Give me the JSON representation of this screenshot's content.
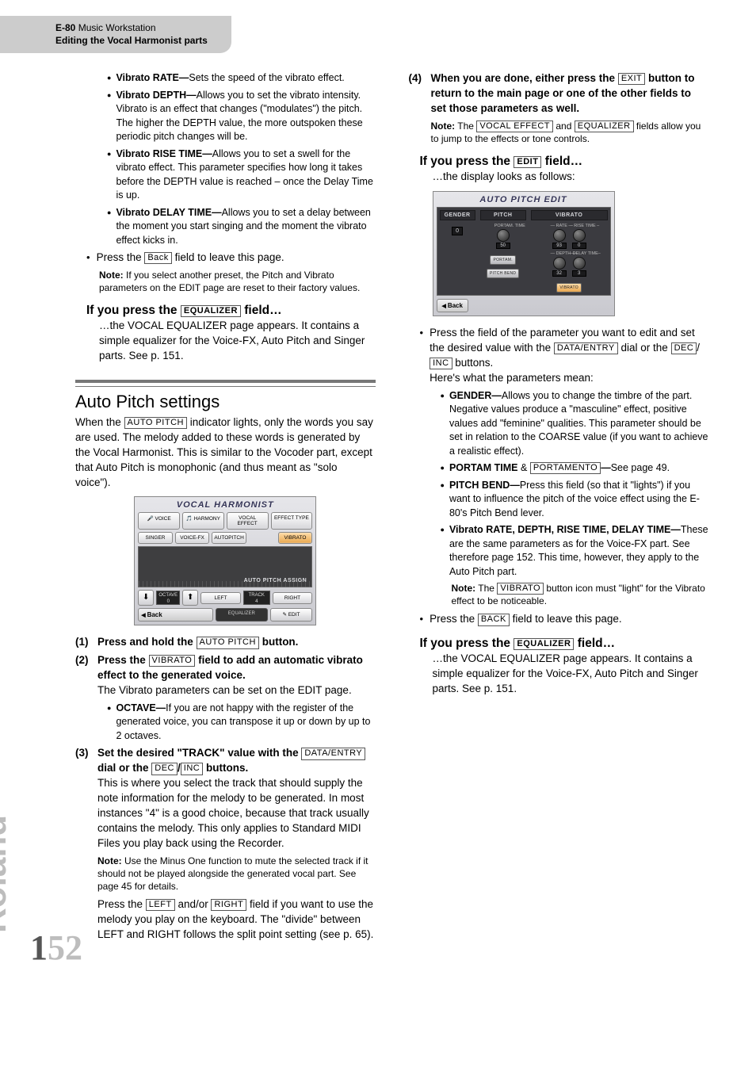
{
  "header": {
    "product": "E-80",
    "product_suffix": "Music Workstation",
    "subtitle": "Editing the Vocal Harmonist parts"
  },
  "col1": {
    "vib_rate": {
      "label": "Vibrato RATE—",
      "text": "Sets the speed of the vibrato effect."
    },
    "vib_depth": {
      "label": "Vibrato DEPTH—",
      "text": "Allows you to set the vibrato intensity. Vibrato is an effect that changes (\"modulates\") the pitch. The higher the DEPTH value, the more outspoken these periodic pitch changes will be."
    },
    "vib_rise": {
      "label": "Vibrato RISE TIME—",
      "text": "Allows you to set a swell for the vibrato effect. This parameter specifies how long it takes before the DEPTH value is reached – once the Delay Time is up."
    },
    "vib_delay": {
      "label": "Vibrato DELAY TIME—",
      "text": "Allows you to set a delay between the moment you start singing and the moment the vibrato effect kicks in."
    },
    "back_bullet": {
      "pre": "Press the ",
      "box": "Back",
      "post": " field to leave this page."
    },
    "back_note": {
      "prefix": "Note:",
      "text": " If you select another preset, the Pitch and Vibrato parameters on the EDIT page are reset to their factory values."
    },
    "eq_head": {
      "pre": "If you press the ",
      "box": "EQUALIZER",
      "post": " field…"
    },
    "eq_body": "…the VOCAL EQUALIZER page appears. It contains a simple equalizer for the Voice-FX, Auto Pitch and Singer parts. See p. 151.",
    "auto_h2": "Auto Pitch settings",
    "auto_intro": {
      "pre": "When the ",
      "box": "AUTO PITCH",
      "post": " indicator lights, only the words you say are used. The melody added to these words is generated by the Vocal Harmonist. This is similar to the Vocoder part, except that Auto Pitch is monophonic (and thus meant as \"solo voice\")."
    },
    "vh_screen": {
      "title": "VOCAL HARMONIST",
      "row1": [
        "VOICE",
        "HARMONY",
        "VOCAL EFFECT",
        "EFFECT TYPE"
      ],
      "row2_left": [
        "SINGER",
        "VOICE-FX",
        "AUTOPITCH"
      ],
      "row2_right": "VIBRATO",
      "assign": "AUTO PITCH ASSIGN",
      "octave_label": "OCTAVE",
      "octave_val": "0",
      "left": "LEFT",
      "right": "RIGHT",
      "track_label": "TRACK",
      "track_val": "4",
      "back": "Back",
      "equalizer": "EQUALIZER",
      "edit": "EDIT"
    },
    "step1": {
      "n": "(1)",
      "pre": "Press and hold the ",
      "box": "AUTO PITCH",
      "post": " button."
    },
    "step2": {
      "n": "(2)",
      "pre": "Press the ",
      "box": "VIBRATO",
      "post": " field to add an automatic vibrato effect to the generated voice.",
      "after": "The Vibrato parameters can be set on the EDIT page."
    },
    "octave_bullet": {
      "label": "OCTAVE—",
      "text": "If you are not happy with the register of the generated voice, you can transpose it up or down by up to 2 octaves."
    },
    "step3": {
      "n": "(3)",
      "line1_pre": "Set the desired \"TRACK\" value with the ",
      "box1": "DATA/ENTRY",
      "mid1": " dial or the ",
      "box2": "DEC",
      "slash": "/",
      "box3": "INC",
      "post1": " buttons.",
      "body": "This is where you select the track that should supply the note information for the melody to be generated. In most instances \"4\" is a good choice, because that track usually contains the melody. This only applies to Standard MIDI Files you play back using the Recorder.",
      "note_prefix": "Note:",
      "note": " Use the Minus One function to mute the selected track if it should not be played alongside the generated vocal part. See page 45 for details.",
      "p2_pre": "Press the ",
      "p2_box1": "LEFT",
      "p2_mid": " and/or ",
      "p2_box2": "RIGHT",
      "p2_post": " field if you want to use the melody you play on the keyboard. The \"divide\" between LEFT and RIGHT follows the split point setting (see p. 65)."
    }
  },
  "col2": {
    "step4": {
      "n": "(4)",
      "pre": "When you are done, either press the ",
      "box": "EXIT",
      "post": " button to return to the main page or one of the other fields to set those parameters as well.",
      "note_prefix": "Note:",
      "note_pre": " The ",
      "note_box1": "VOCAL EFFECT",
      "note_mid": " and ",
      "note_box2": "EQUALIZER",
      "note_post": " fields allow you to jump to the effects or tone controls."
    },
    "edit_head": {
      "pre": "If you press the ",
      "box": "EDIT",
      "post": " field…"
    },
    "edit_body": "…the display looks as follows:",
    "ape_screen": {
      "title": "AUTO PITCH EDIT",
      "gender_hdr": "GENDER",
      "gender_val": "0",
      "pitch_hdr": "PITCH",
      "portam_label": "PORTAM. TIME",
      "portam_val": "50",
      "portam_toggle": "PORTAM.",
      "pitchbend_toggle": "PITCH BEND",
      "vibrato_hdr": "VIBRATO",
      "rate_label": "RATE",
      "rate_val": "93",
      "rise_label": "RISE TIME",
      "rise_val": "0",
      "depth_label": "DEPTH",
      "depth_val": "32",
      "delay_label": "DELAY TIME",
      "delay_val": "3",
      "vibrato_toggle": "VIBRATO",
      "back": "Back"
    },
    "edit_bullet": {
      "pre": "Press the field of the parameter you want to edit and set the desired value with the ",
      "box1": "DATA/ENTRY",
      "mid": " dial or the ",
      "box2": "DEC",
      "slash": "/",
      "box3": "INC",
      "post": " buttons.",
      "after": "Here's what the parameters mean:"
    },
    "gender": {
      "label": "GENDER—",
      "text": "Allows you to change the timbre of the part. Negative values produce a \"masculine\" effect, positive values add \"feminine\" qualities. This parameter should be set in relation to the COARSE value (if you want to achieve a realistic effect)."
    },
    "portam": {
      "label": "PORTAM TIME",
      "amp": " & ",
      "box": "PORTAMENTO",
      "dash": "—",
      "text": "See page 49."
    },
    "pitchbend": {
      "label": "PITCH BEND—",
      "text": "Press this field (so that it \"lights\") if you want to influence the pitch of the voice effect using the E-80's Pitch Bend lever."
    },
    "vib4": {
      "label": "Vibrato RATE, DEPTH, RISE TIME, DELAY TIME—",
      "text": "These are the same parameters as for the Voice-FX part. See therefore page 152. This time, however, they apply to the Auto Pitch part.",
      "note_prefix": "Note:",
      "note_pre": " The ",
      "note_box": "VIBRATO",
      "note_post": " button icon must \"light\" for the Vibrato effect to be noticeable."
    },
    "back_bullet2": {
      "pre": "Press the ",
      "box": "BACK",
      "post": " field to leave this page."
    },
    "eq_head2": {
      "pre": "If you press the ",
      "box": "EQUALIZER",
      "post": " field…"
    },
    "eq_body2": "…the VOCAL EQUALIZER page appears. It contains a simple equalizer for the Voice-FX, Auto Pitch and Singer parts. See p. 151."
  },
  "brand": "Roland",
  "page_number": {
    "bold": "1",
    "gray": "52"
  }
}
